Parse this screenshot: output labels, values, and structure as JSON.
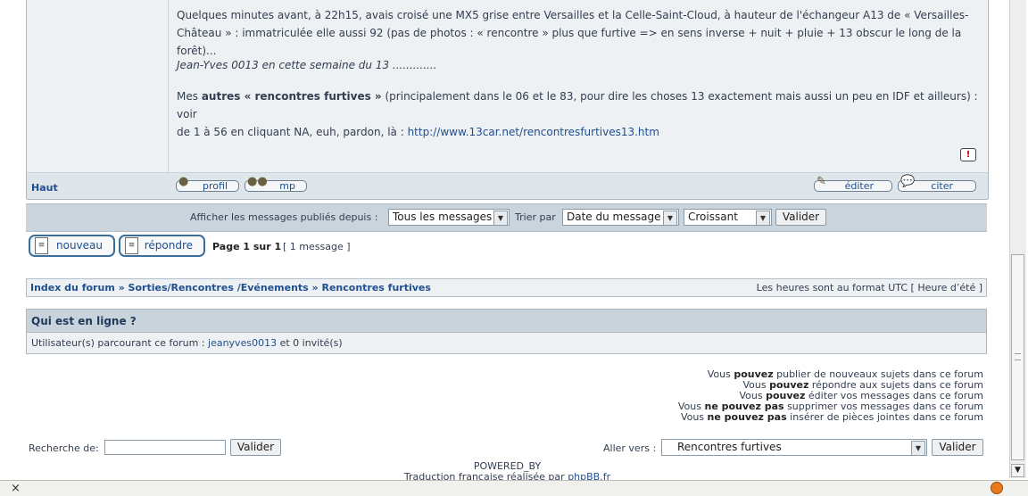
{
  "post": {
    "paragraph1_line1": "Quelques minutes avant, à 22h15, avais croisé  une MX5 grise entre Versailles et la Celle-Saint-Cloud, à hauteur de l'échangeur A13 de « Versailles-",
    "paragraph1_line2": "Château » : immatriculée elle aussi 92 (pas de photos : « rencontre » plus que furtive => en sens inverse + nuit + pluie + 13 obscur le long de la forêt)...",
    "signature": "Jean-Yves 0013 en cette semaine du 13 .............",
    "p3_mes": "Mes ",
    "p3_bold": "autres « rencontres furtives »",
    "p3_rest": " (principalement dans le 06 et le 83, pour dire les choses 13 exactement mais aussi un peu en IDF et ailleurs) : voir",
    "p3_line2": "de 1 à 56 en cliquant NA, euh, pardon, là : ",
    "p3_link": "http://www.13car.net/rencontresfurtives13.htm",
    "report_icon": "!",
    "haut_label": "Haut",
    "profil_label": "profil",
    "mp_label": "mp",
    "editer_label": "éditer",
    "citer_label": "citer"
  },
  "filter": {
    "afficher_label": "Afficher les messages publiés depuis :",
    "period_value": "Tous les messages",
    "trier_label": "Trier par",
    "sort_value": "Date du message",
    "order_value": "Croissant",
    "valider_label": "Valider"
  },
  "actions": {
    "nouveau_label": "nouveau",
    "repondre_label": "répondre",
    "page_info": "Page 1 sur 1",
    "message_count": "[ 1 message ]"
  },
  "breadcrumb": {
    "index": "Index du forum",
    "sep": " » ",
    "section": "Sorties/Rencontres /Evénements",
    "forum": "Rencontres furtives",
    "timezone": "Les heures sont au format UTC [ Heure d’été ]"
  },
  "online": {
    "title": "Qui est en ligne ?",
    "text_prefix": "Utilisateur(s) parcourant ce forum : ",
    "user": "jeanyves0013",
    "text_suffix": " et 0 invité(s)"
  },
  "permissions": [
    {
      "pre": "Vous ",
      "bold": "pouvez",
      "post": " publier de nouveaux sujets dans ce forum"
    },
    {
      "pre": "Vous ",
      "bold": "pouvez",
      "post": " répondre aux sujets dans ce forum"
    },
    {
      "pre": "Vous ",
      "bold": "pouvez",
      "post": " éditer vos messages dans ce forum"
    },
    {
      "pre": "Vous ",
      "bold": "ne pouvez pas",
      "post": " supprimer vos messages dans ce forum"
    },
    {
      "pre": "Vous ",
      "bold": "ne pouvez pas",
      "post": " insérer de pièces jointes dans ce forum"
    }
  ],
  "search": {
    "label": "Recherche de:",
    "value": "",
    "valider_label": "Valider"
  },
  "jump": {
    "label": "Aller vers :",
    "value": "Rencontres furtives",
    "valider_label": "Valider"
  },
  "footer": {
    "powered": "POWERED_BY",
    "traduction_prefix": "Traduction française réalisée par ",
    "traduction_link": "phpBB.fr"
  },
  "statusbar": {
    "close_glyph": "×"
  }
}
